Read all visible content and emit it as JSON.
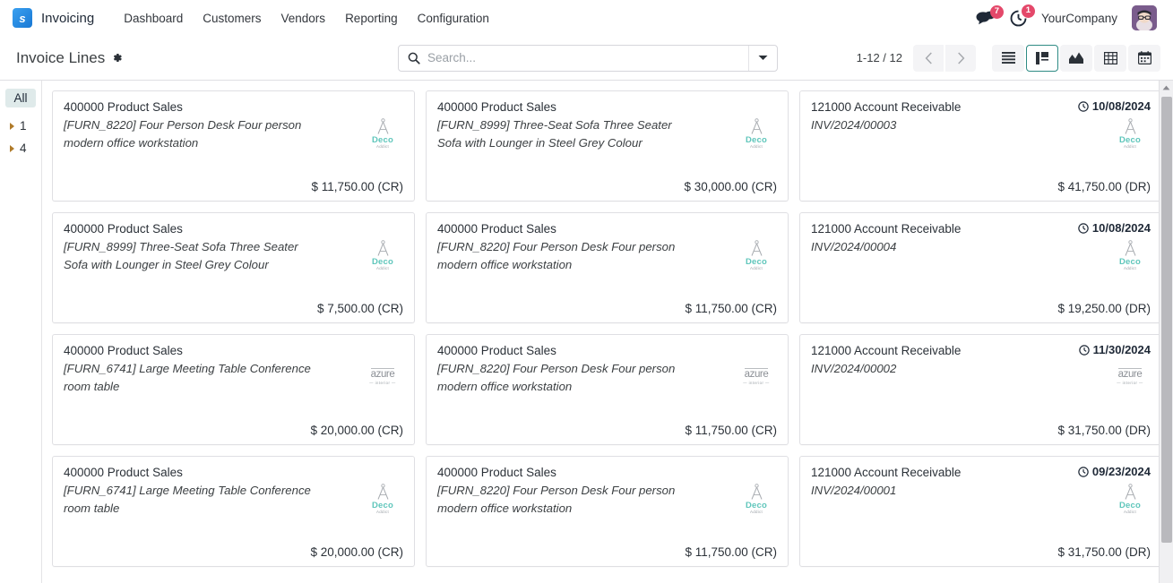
{
  "navbar": {
    "logo_icon": "odoo-invoicing-logo-icon",
    "brand": "Invoicing",
    "menus": [
      "Dashboard",
      "Customers",
      "Vendors",
      "Reporting",
      "Configuration"
    ],
    "messages_icon": "chat-bubble-icon",
    "messages_count": "7",
    "activities_icon": "clock-activity-icon",
    "activities_count": "1",
    "company": "YourCompany",
    "avatar_icon": "user-avatar"
  },
  "control_panel": {
    "title": "Invoice Lines",
    "settings_icon": "gear-icon",
    "search": {
      "icon": "search-icon",
      "placeholder": "Search...",
      "value": "",
      "dropdown_icon": "caret-down-icon"
    },
    "pager": {
      "range": "1-12 / 12",
      "prev_icon": "chevron-left-icon",
      "next_icon": "chevron-right-icon"
    },
    "views": [
      {
        "name": "list",
        "icon": "list-view-icon",
        "active": false
      },
      {
        "name": "kanban",
        "icon": "kanban-view-icon",
        "active": true
      },
      {
        "name": "graph",
        "icon": "graph-view-icon",
        "active": false
      },
      {
        "name": "pivot",
        "icon": "pivot-view-icon",
        "active": false
      },
      {
        "name": "calendar",
        "icon": "calendar-view-icon",
        "active": false
      }
    ]
  },
  "sidebar": {
    "all_label": "All",
    "items": [
      {
        "label": "1",
        "caret_icon": "caret-right-icon"
      },
      {
        "label": "4",
        "caret_icon": "caret-right-icon"
      }
    ]
  },
  "kanban": {
    "cards": [
      {
        "account": "400000 Product Sales",
        "description": "[FURN_8220] Four Person Desk Four person modern office workstation",
        "date": "",
        "amount": "$ 11,750.00 (CR)",
        "logo": "deco"
      },
      {
        "account": "400000 Product Sales",
        "description": "[FURN_8999] Three-Seat Sofa Three Seater Sofa with Lounger in Steel Grey Colour",
        "date": "",
        "amount": "$ 30,000.00 (CR)",
        "logo": "deco"
      },
      {
        "account": "121000 Account Receivable",
        "description": "INV/2024/00003",
        "date": "10/08/2024",
        "amount": "$ 41,750.00 (DR)",
        "logo": "deco"
      },
      {
        "account": "400000 Product Sales",
        "description": "[FURN_8999] Three-Seat Sofa Three Seater Sofa with Lounger in Steel Grey Colour",
        "date": "",
        "amount": "$ 7,500.00 (CR)",
        "logo": "deco"
      },
      {
        "account": "400000 Product Sales",
        "description": "[FURN_8220] Four Person Desk Four person modern office workstation",
        "date": "",
        "amount": "$ 11,750.00 (CR)",
        "logo": "deco"
      },
      {
        "account": "121000 Account Receivable",
        "description": "INV/2024/00004",
        "date": "10/08/2024",
        "amount": "$ 19,250.00 (DR)",
        "logo": "deco"
      },
      {
        "account": "400000 Product Sales",
        "description": "[FURN_6741] Large Meeting Table Conference room table",
        "date": "",
        "amount": "$ 20,000.00 (CR)",
        "logo": "azure"
      },
      {
        "account": "400000 Product Sales",
        "description": "[FURN_8220] Four Person Desk Four person modern office workstation",
        "date": "",
        "amount": "$ 11,750.00 (CR)",
        "logo": "azure"
      },
      {
        "account": "121000 Account Receivable",
        "description": "INV/2024/00002",
        "date": "11/30/2024",
        "amount": "$ 31,750.00 (DR)",
        "logo": "azure"
      },
      {
        "account": "400000 Product Sales",
        "description": "[FURN_6741] Large Meeting Table Conference room table",
        "date": "",
        "amount": "$ 20,000.00 (CR)",
        "logo": "deco"
      },
      {
        "account": "400000 Product Sales",
        "description": "[FURN_8220] Four Person Desk Four person modern office workstation",
        "date": "",
        "amount": "$ 11,750.00 (CR)",
        "logo": "deco"
      },
      {
        "account": "121000 Account Receivable",
        "description": "INV/2024/00001",
        "date": "09/23/2024",
        "amount": "$ 31,750.00 (DR)",
        "logo": "deco"
      }
    ],
    "logo_labels": {
      "deco_word": "Deco",
      "deco_sub": "Addict",
      "azure_word": "azure",
      "azure_sub": "— interior —"
    },
    "date_icon": "clock-icon"
  },
  "scrollbar": {
    "up_arrow_icon": "scroll-up-arrow-icon"
  }
}
